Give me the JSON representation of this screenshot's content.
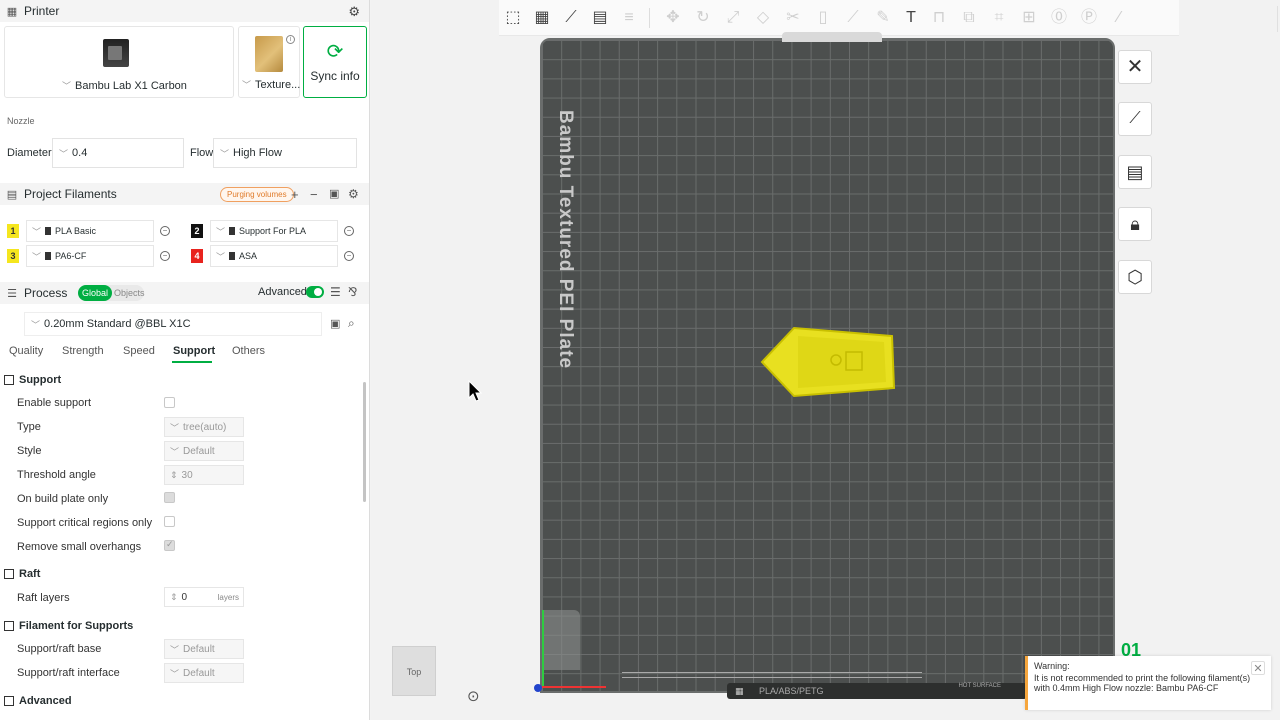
{
  "printer": {
    "section_title": "Printer",
    "printer_name": "Bambu Lab X1 Carbon",
    "plate_name": "Texture...",
    "sync_label": "Sync info",
    "nozzle_title": "Nozzle",
    "diameter_label": "Diameter",
    "diameter_value": "0.4",
    "flow_label": "Flow",
    "flow_value": "High Flow"
  },
  "filaments": {
    "section_title": "Project Filaments",
    "purging_label": "Purging volumes",
    "items": [
      {
        "num": "1",
        "name": "PLA Basic",
        "color": "#f5e61e",
        "text_color": "#333333"
      },
      {
        "num": "2",
        "name": "Support For PLA",
        "color": "#111111",
        "text_color": "#ffffff"
      },
      {
        "num": "3",
        "name": "PA6-CF",
        "color": "#f5e61e",
        "text_color": "#333333"
      },
      {
        "num": "4",
        "name": "ASA",
        "color": "#e8231e",
        "text_color": "#ffffff"
      }
    ]
  },
  "process": {
    "section_title": "Process",
    "global_label": "Global",
    "objects_label": "Objects",
    "advanced_label": "Advanced",
    "preset": "0.20mm Standard @BBL X1C",
    "tabs": [
      "Quality",
      "Strength",
      "Speed",
      "Support",
      "Others"
    ],
    "active_tab": "Support"
  },
  "support": {
    "group_title": "Support",
    "enable_label": "Enable support",
    "type_label": "Type",
    "type_value": "tree(auto)",
    "style_label": "Style",
    "style_value": "Default",
    "threshold_label": "Threshold angle",
    "threshold_value": "30",
    "build_plate_label": "On build plate only",
    "critical_label": "Support critical regions only",
    "overhangs_label": "Remove small overhangs"
  },
  "raft": {
    "group_title": "Raft",
    "layers_label": "Raft layers",
    "layers_value": "0",
    "layers_unit": "layers"
  },
  "filament_supports": {
    "group_title": "Filament for Supports",
    "base_label": "Support/raft base",
    "base_value": "Default",
    "interface_label": "Support/raft interface",
    "interface_value": "Default"
  },
  "advanced": {
    "group_title": "Advanced"
  },
  "viewport": {
    "plate_label": "Bambu Textured PEI Plate",
    "plate_type": "PLA/ABS/PETG",
    "hot_surface": "HOT SURFACE",
    "view_label": "Top",
    "plate_number": "01"
  },
  "warning": {
    "title": "Warning:",
    "message": "It is not recommended to print the following filament(s) with 0.4mm High Flow nozzle: Bambu PA6-CF"
  },
  "colors": {
    "accent": "#00ae42",
    "model": "#e8e020",
    "plate": "#4c4f4e",
    "warning": "#f6a63d"
  }
}
